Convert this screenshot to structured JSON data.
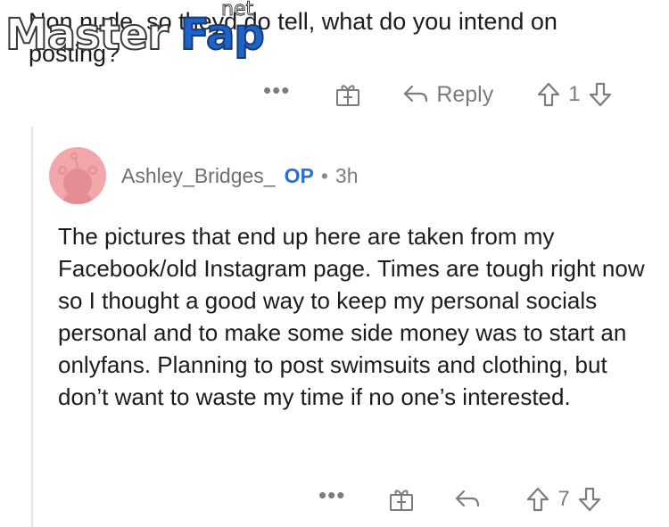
{
  "parent_comment": {
    "text": "Non nude, so theyd do tell, what do you intend on posting?",
    "actions": {
      "more_label": "•••",
      "reply_label": "Reply",
      "vote_count": "1"
    }
  },
  "watermark": {
    "part1": "Master",
    "part2": "Fap",
    "part3": "net"
  },
  "reply_comment": {
    "username": "Ashley_Bridges_",
    "op_badge": "OP",
    "separator": "•",
    "time": "3h",
    "body": "The pictures that end up here are taken from my Facebook/old Instagram page. Times are tough right now so I thought a good way to keep my personal socials personal and to make some side money was to start an onlyfans. Planning to post swimsuits and clothing, but don’t want to waste my time if no one’s interested.",
    "actions": {
      "more_label": "•••",
      "vote_count": "7"
    }
  },
  "colors": {
    "accent_op": "#2d6fd3",
    "avatar_bg": "#f2a7ad",
    "muted": "#7c7c7c"
  },
  "icons": [
    "gift-icon",
    "reply-arrow-icon",
    "upvote-icon",
    "downvote-icon",
    "snoo-avatar-icon"
  ]
}
